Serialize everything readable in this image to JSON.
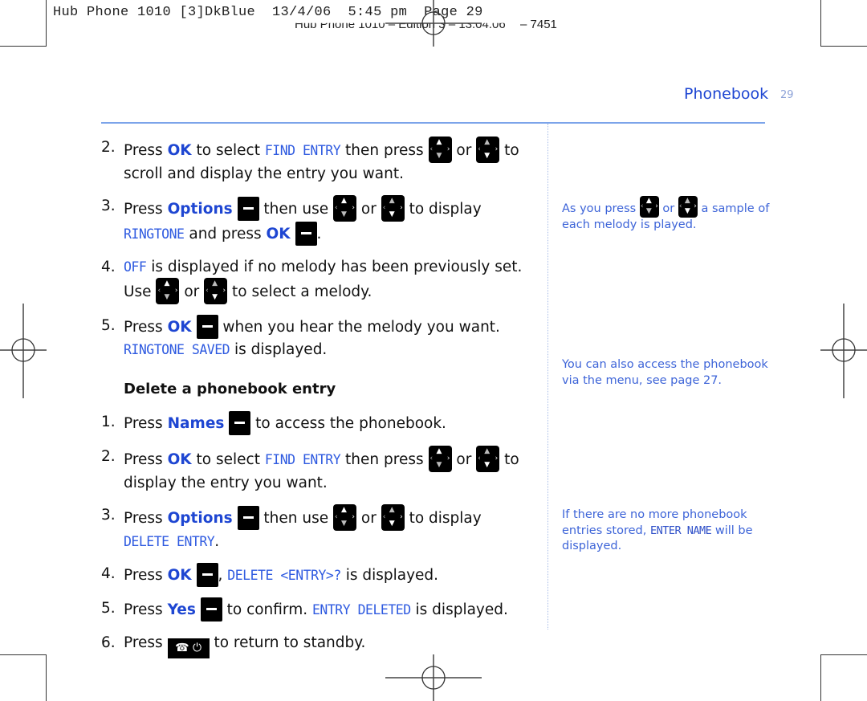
{
  "slug": {
    "line1": "Hub Phone 1010 [3]DkBlue  13/4/06  5:45 pm  Page 29",
    "line2": "Hub Phone 1010 – Edition 3 – 13.04.06",
    "line2_tail": "– 7451"
  },
  "header": {
    "section_title": "Phonebook",
    "page_number": "29"
  },
  "main": {
    "steps_a": [
      {
        "num": "2.",
        "pre": "Press ",
        "kw": "OK",
        "mid1": " to select ",
        "lcd": "FIND ENTRY",
        "mid2": " then press ",
        "or": " or ",
        "post": " to scroll and display the entry you want."
      },
      {
        "num": "3.",
        "pre": "Press ",
        "kw": "Options",
        "mid1": " then use ",
        "or": " or ",
        "mid2": " to display ",
        "lcd": "RINGTONE",
        "mid3": " and press ",
        "kw2": "OK",
        "post": "."
      },
      {
        "num": "4.",
        "lcd": "OFF",
        "mid1": " is displayed if no melody has been previously set. Use ",
        "or": " or ",
        "post": " to select a melody."
      },
      {
        "num": "5.",
        "pre": "Press ",
        "kw": "OK",
        "mid1": " when you hear the melody you want. ",
        "lcd": "RINGTONE SAVED",
        "post": " is displayed."
      }
    ],
    "delete_heading": "Delete a phonebook entry",
    "steps_b": [
      {
        "num": "1.",
        "pre": "Press ",
        "kw": "Names",
        "post": " to access the phonebook."
      },
      {
        "num": "2.",
        "pre": "Press ",
        "kw": "OK",
        "mid1": " to select ",
        "lcd": "FIND ENTRY",
        "mid2": " then press ",
        "or": " or ",
        "post": " to display the entry you want."
      },
      {
        "num": "3.",
        "pre": "Press ",
        "kw": "Options",
        "mid1": " then use ",
        "or": " or ",
        "mid2": " to display ",
        "lcd": "DELETE ENTRY",
        "post": "."
      },
      {
        "num": "4.",
        "pre": "Press ",
        "kw": "OK",
        "mid1": ", ",
        "lcd": "DELETE <ENTRY>?",
        "post": " is displayed."
      },
      {
        "num": "5.",
        "pre": "Press ",
        "kw": "Yes",
        "mid1": " to confirm. ",
        "lcd": "ENTRY DELETED",
        "post": " is displayed."
      },
      {
        "num": "6.",
        "pre": "Press ",
        "post": " to return to standby."
      }
    ]
  },
  "sidebar": {
    "note1": {
      "pre": "As you press ",
      "or": " or ",
      "post": " a sample of each melody is played."
    },
    "note2": "You can also access the phonebook via the menu, see page 27.",
    "note3": {
      "pre": "If there are no more phonebook entries stored, ",
      "lcd": "ENTER NAME",
      "post": " will be displayed."
    }
  },
  "icons": {
    "end_call": "☎",
    "power": "⏻"
  }
}
